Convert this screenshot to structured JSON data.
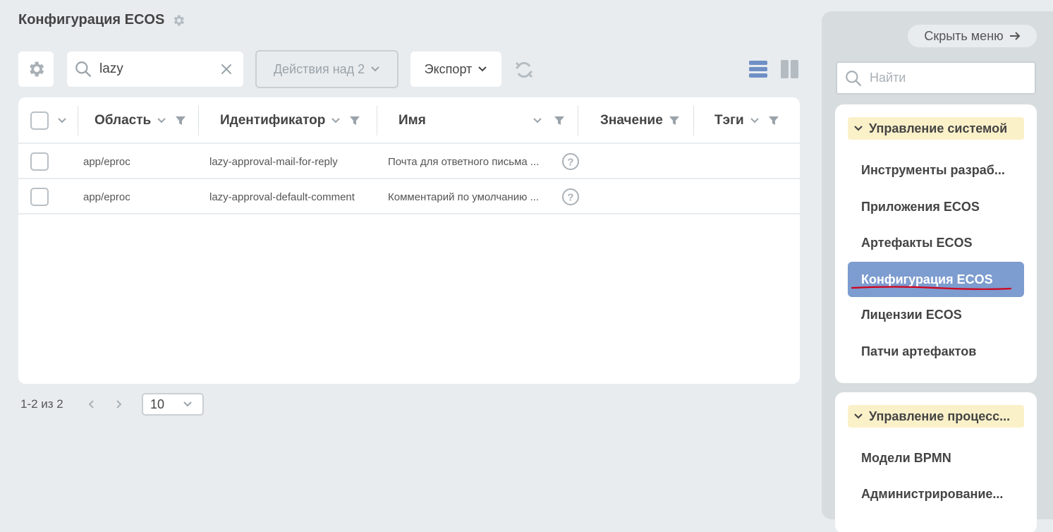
{
  "page": {
    "title": "Конфигурация ECOS"
  },
  "toolbar": {
    "search_value": "lazy",
    "actions_label": "Действия над 2",
    "export_label": "Экспорт"
  },
  "table": {
    "columns": [
      "Область",
      "Идентификатор",
      "Имя",
      "Значение",
      "Тэги"
    ],
    "rows": [
      {
        "area": "app/eproc",
        "id": "lazy-approval-mail-for-reply",
        "name": "Почта для ответного письма ..."
      },
      {
        "area": "app/eproc",
        "id": "lazy-approval-default-comment",
        "name": "Комментарий по умолчанию ..."
      }
    ]
  },
  "pagination": {
    "summary": "1-2 из 2",
    "page_size": "10"
  },
  "sidebar": {
    "hide_menu_label": "Скрыть меню",
    "search_placeholder": "Найти",
    "groups": [
      {
        "title": "Управление системой",
        "items": [
          {
            "label": "Инструменты разраб..."
          },
          {
            "label": "Приложения ECOS"
          },
          {
            "label": "Артефакты ECOS"
          },
          {
            "label": "Конфигурация ECOS",
            "active": true
          },
          {
            "label": "Лицензии ECOS"
          },
          {
            "label": "Патчи артефактов"
          }
        ]
      },
      {
        "title": "Управление процесс...",
        "items": [
          {
            "label": "Модели BPMN"
          },
          {
            "label": "Администрирование..."
          }
        ]
      }
    ]
  },
  "colors": {
    "accent": "#7d9ccf",
    "group_bg": "#fbf1c9",
    "underline": "#d0021b"
  },
  "icons": [
    "settings-icon",
    "search-icon",
    "clear-icon",
    "chevron-down-icon",
    "refresh-icon",
    "list-view-icon",
    "columns-view-icon",
    "filter-icon",
    "help-icon",
    "arrow-right-icon",
    "chevron-left-icon",
    "chevron-right-icon"
  ]
}
